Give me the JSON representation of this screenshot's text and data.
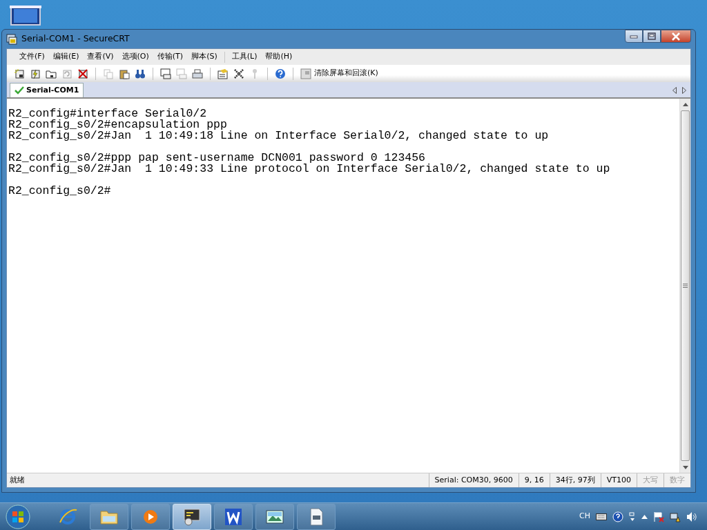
{
  "window": {
    "title": "Serial-COM1 - SecureCRT"
  },
  "menu": [
    "文件(F)",
    "编辑(E)",
    "查看(V)",
    "选项(O)",
    "传输(T)",
    "脚本(S)",
    "工具(L)",
    "帮助(H)"
  ],
  "toolbar": [
    [
      {
        "kind": "connect",
        "disabled": false
      },
      {
        "kind": "quick-connect",
        "disabled": false
      },
      {
        "kind": "connect-tab",
        "disabled": false
      },
      {
        "kind": "reconnect",
        "disabled": true
      },
      {
        "kind": "disconnect",
        "disabled": false
      }
    ],
    [
      {
        "kind": "copy",
        "disabled": true
      },
      {
        "kind": "paste",
        "disabled": false
      },
      {
        "kind": "find",
        "disabled": false
      }
    ],
    [
      {
        "kind": "print-screen",
        "disabled": false
      },
      {
        "kind": "print-selection",
        "disabled": true
      },
      {
        "kind": "print",
        "disabled": false
      }
    ],
    [
      {
        "kind": "session-options",
        "disabled": false
      },
      {
        "kind": "global-options",
        "disabled": false
      },
      {
        "kind": "key",
        "disabled": true
      }
    ],
    [
      {
        "kind": "help",
        "disabled": false
      }
    ]
  ],
  "clear_button": {
    "label": "清除屏幕和回滚(K)"
  },
  "tabs": [
    {
      "label": "Serial-COM1",
      "selected": true,
      "connected": true
    }
  ],
  "terminal": {
    "blocks": [
      [
        "R2_config#interface Serial0/2",
        "R2_config_s0/2#encapsulation ppp",
        "R2_config_s0/2#Jan  1 10:49:18 Line on Interface Serial0/2, changed state to up"
      ],
      [
        "R2_config_s0/2#ppp pap sent-username DCN001 password 0 123456",
        "R2_config_s0/2#Jan  1 10:49:33 Line protocol on Interface Serial0/2, changed state to up"
      ],
      [
        "R2_config_s0/2#"
      ]
    ]
  },
  "status_bar": {
    "message": "就绪",
    "panes": [
      "Serial: COM30, 9600",
      "9,  16",
      "34行, 97列",
      "VT100"
    ],
    "indicators": [
      {
        "label": "大写",
        "disabled": true
      },
      {
        "label": "数字",
        "disabled": true
      }
    ]
  },
  "taskbar": {
    "apps": [
      {
        "kind": "browser",
        "active": false
      },
      {
        "kind": "folder",
        "active": false
      },
      {
        "kind": "media",
        "active": false
      },
      {
        "kind": "terminal",
        "active": true
      },
      {
        "kind": "writer",
        "active": false
      },
      {
        "kind": "photo",
        "active": false
      },
      {
        "kind": "document",
        "active": false
      }
    ],
    "language": "CH"
  }
}
